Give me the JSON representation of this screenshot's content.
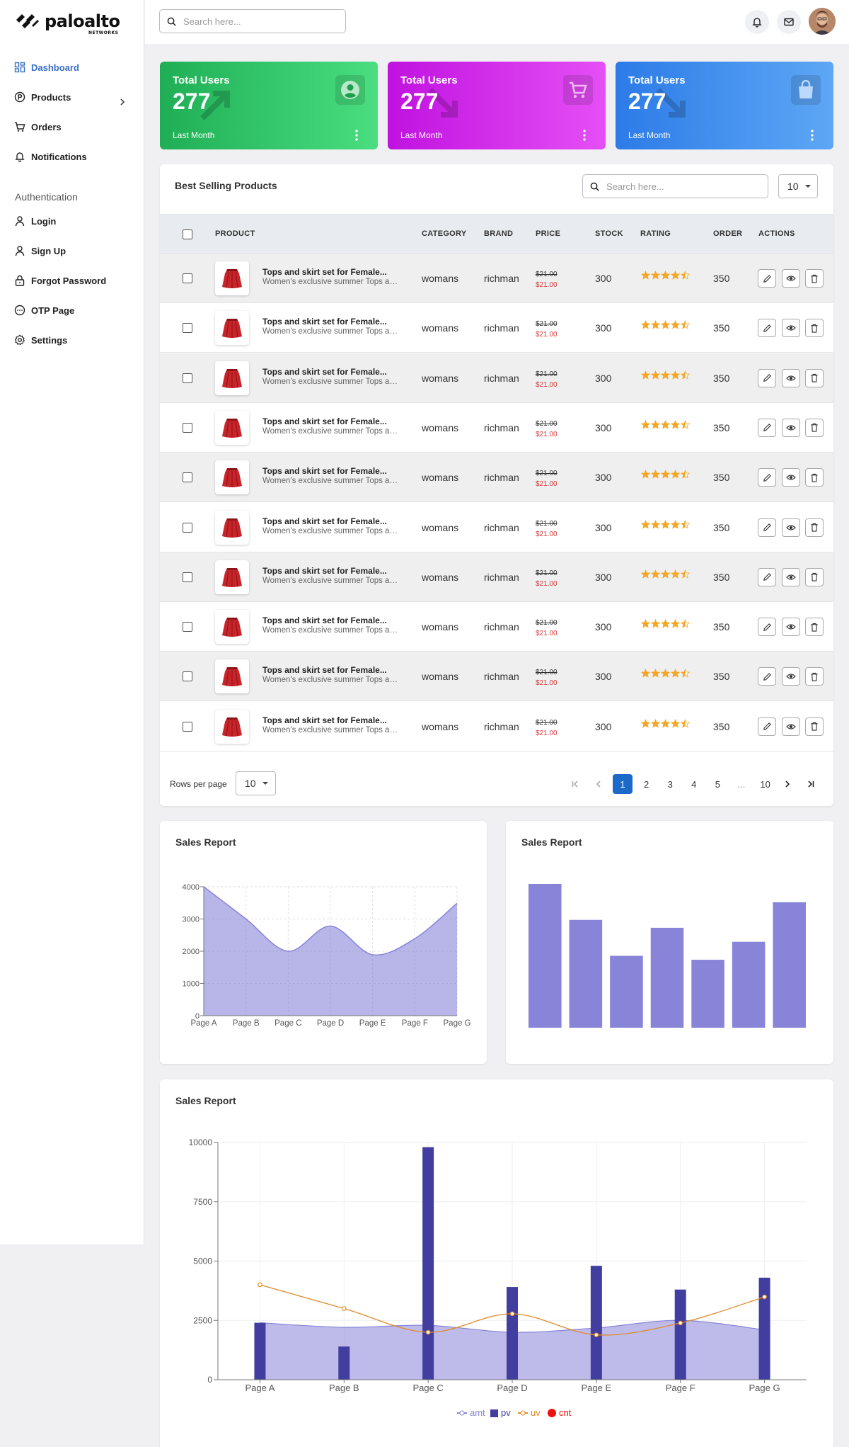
{
  "brand": {
    "name": "paloalto",
    "sub": "NETWORKS"
  },
  "sidebar": {
    "items": [
      {
        "label": "Dashboard"
      },
      {
        "label": "Products"
      },
      {
        "label": "Orders"
      },
      {
        "label": "Notifications"
      }
    ],
    "section_label": "Authentication",
    "auth_items": [
      {
        "label": "Login"
      },
      {
        "label": "Sign Up"
      },
      {
        "label": "Forgot Password"
      },
      {
        "label": "OTP Page"
      },
      {
        "label": "Settings"
      }
    ]
  },
  "header": {
    "search_placeholder": "Search here..."
  },
  "stats": [
    {
      "title": "Total Users",
      "value": "277",
      "footer": "Last Month",
      "icon": "user-circle-icon",
      "color_from": "#1fae55",
      "color_to": "#4ade80"
    },
    {
      "title": "Total Users",
      "value": "277",
      "footer": "Last Month",
      "icon": "cart-icon",
      "color_from": "#c012e0",
      "color_to": "#e54ff5"
    },
    {
      "title": "Total Users",
      "value": "277",
      "footer": "Last Month",
      "icon": "bag-icon",
      "color_from": "#2c7be8",
      "color_to": "#5ea7f5"
    }
  ],
  "table": {
    "title": "Best Selling Products",
    "search_placeholder": "Search here...",
    "page_size": "10",
    "columns": [
      "PRODUCT",
      "CATEGORY",
      "BRAND",
      "PRICE",
      "STOCK",
      "RATING",
      "ORDER",
      "ACTIONS"
    ],
    "rows": [
      {
        "name": "Tops and skirt set for Female...",
        "desc": "Women's exclusive summer Tops and skirt set",
        "category": "womans",
        "brand": "richman",
        "old_price": "$21.00",
        "price": "$21.00",
        "stock": "300",
        "rating": 4.5,
        "order": "350"
      },
      {
        "name": "Tops and skirt set for Female...",
        "desc": "Women's exclusive summer Tops and skirt set",
        "category": "womans",
        "brand": "richman",
        "old_price": "$21.00",
        "price": "$21.00",
        "stock": "300",
        "rating": 4.5,
        "order": "350"
      },
      {
        "name": "Tops and skirt set for Female...",
        "desc": "Women's exclusive summer Tops and skirt set",
        "category": "womans",
        "brand": "richman",
        "old_price": "$21.00",
        "price": "$21.00",
        "stock": "300",
        "rating": 4.5,
        "order": "350"
      },
      {
        "name": "Tops and skirt set for Female...",
        "desc": "Women's exclusive summer Tops and skirt set",
        "category": "womans",
        "brand": "richman",
        "old_price": "$21.00",
        "price": "$21.00",
        "stock": "300",
        "rating": 4.5,
        "order": "350"
      },
      {
        "name": "Tops and skirt set for Female...",
        "desc": "Women's exclusive summer Tops and skirt set",
        "category": "womans",
        "brand": "richman",
        "old_price": "$21.00",
        "price": "$21.00",
        "stock": "300",
        "rating": 4.5,
        "order": "350"
      },
      {
        "name": "Tops and skirt set for Female...",
        "desc": "Women's exclusive summer Tops and skirt set",
        "category": "womans",
        "brand": "richman",
        "old_price": "$21.00",
        "price": "$21.00",
        "stock": "300",
        "rating": 4.5,
        "order": "350"
      },
      {
        "name": "Tops and skirt set for Female...",
        "desc": "Women's exclusive summer Tops and skirt set",
        "category": "womans",
        "brand": "richman",
        "old_price": "$21.00",
        "price": "$21.00",
        "stock": "300",
        "rating": 4.5,
        "order": "350"
      },
      {
        "name": "Tops and skirt set for Female...",
        "desc": "Women's exclusive summer Tops and skirt set",
        "category": "womans",
        "brand": "richman",
        "old_price": "$21.00",
        "price": "$21.00",
        "stock": "300",
        "rating": 4.5,
        "order": "350"
      },
      {
        "name": "Tops and skirt set for Female...",
        "desc": "Women's exclusive summer Tops and skirt set",
        "category": "womans",
        "brand": "richman",
        "old_price": "$21.00",
        "price": "$21.00",
        "stock": "300",
        "rating": 4.5,
        "order": "350"
      },
      {
        "name": "Tops and skirt set for Female...",
        "desc": "Women's exclusive summer Tops and skirt set",
        "category": "womans",
        "brand": "richman",
        "old_price": "$21.00",
        "price": "$21.00",
        "stock": "300",
        "rating": 4.5,
        "order": "350"
      }
    ],
    "rows_per_page_label": "Rows per page",
    "rows_per_page": "10",
    "pages": [
      "1",
      "2",
      "3",
      "4",
      "5",
      "...",
      "10"
    ],
    "current_page": "1"
  },
  "colors": {
    "accent": "#3a6fc4",
    "area": "#8884d8",
    "bar": "#413ea0",
    "line": "#e08a28",
    "star": "#f5a623",
    "red": "#d83a3a"
  },
  "chart_data": [
    {
      "type": "area",
      "title": "Sales Report",
      "categories": [
        "Page A",
        "Page B",
        "Page C",
        "Page D",
        "Page E",
        "Page F",
        "Page G"
      ],
      "values": [
        4000,
        3000,
        2000,
        2780,
        1890,
        2390,
        3490
      ],
      "yticks": [
        "0",
        "1000",
        "2000",
        "3000",
        "4000"
      ],
      "ylim": [
        0,
        4000
      ],
      "grid": true
    },
    {
      "type": "bar",
      "title": "Sales Report",
      "values": [
        4000,
        3000,
        2000,
        2780,
        1890,
        2390,
        3490
      ],
      "ylim": [
        0,
        4000
      ]
    },
    {
      "type": "composed",
      "title": "Sales Report",
      "categories": [
        "Page A",
        "Page B",
        "Page C",
        "Page D",
        "Page E",
        "Page F",
        "Page G"
      ],
      "series": [
        {
          "name": "amt",
          "kind": "area",
          "values": [
            2400,
            2210,
            2290,
            2000,
            2181,
            2500,
            2100
          ]
        },
        {
          "name": "pv",
          "kind": "bar",
          "values": [
            2400,
            1398,
            9800,
            3908,
            4800,
            3800,
            4300
          ]
        },
        {
          "name": "uv",
          "kind": "line",
          "values": [
            4000,
            3000,
            2000,
            2780,
            1890,
            2390,
            3490
          ]
        },
        {
          "name": "cnt",
          "kind": "scatter",
          "values": []
        }
      ],
      "yticks": [
        "0",
        "2500",
        "5000",
        "7500",
        "10000"
      ],
      "ylim": [
        0,
        10000
      ],
      "grid": true,
      "legend": "bottom"
    }
  ]
}
